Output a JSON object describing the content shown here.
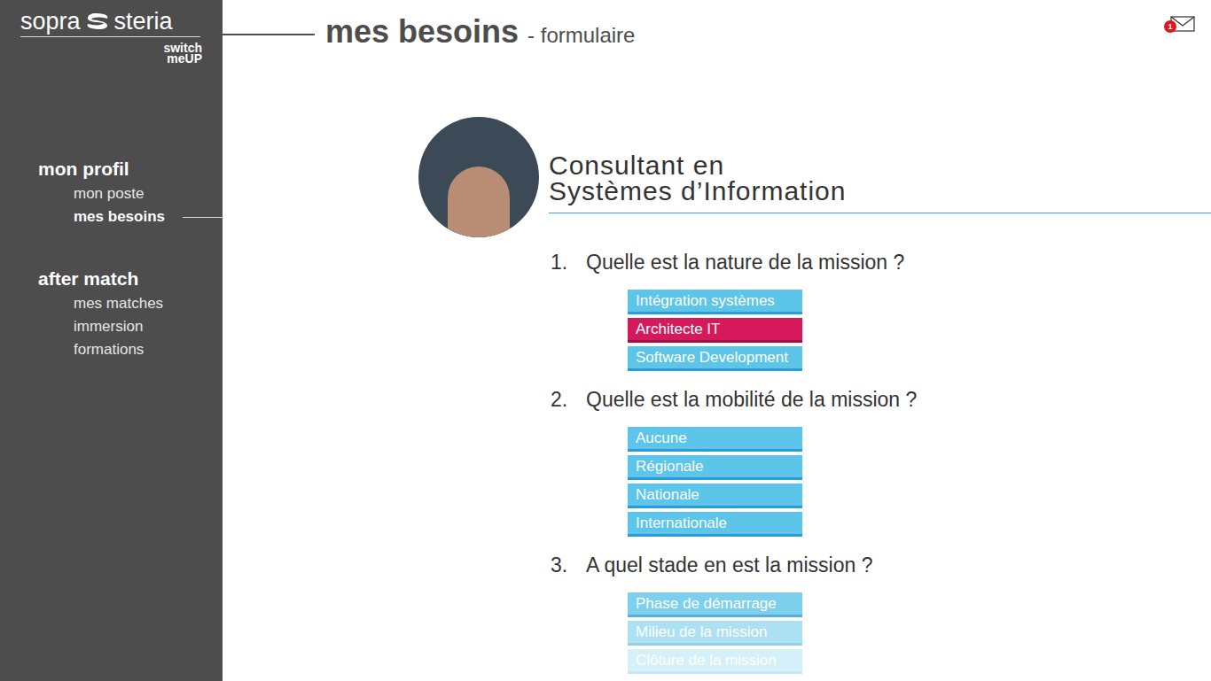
{
  "logo": {
    "left": "sopra",
    "right": "steria",
    "sub_top": "switch",
    "sub_bottom": "meUP"
  },
  "header": {
    "title": "mes besoins",
    "subtitle": "- formulaire"
  },
  "notifications": {
    "count": "1"
  },
  "sidebar": {
    "sections": [
      {
        "title": "mon profil",
        "items": [
          {
            "label": "mon poste",
            "selected": false
          },
          {
            "label": "mes besoins",
            "selected": true
          }
        ]
      },
      {
        "title": "after match",
        "items": [
          {
            "label": "mes matches",
            "selected": false
          },
          {
            "label": "immersion",
            "selected": false
          },
          {
            "label": "formations",
            "selected": false
          }
        ]
      }
    ]
  },
  "profile": {
    "title_lines": [
      "Consultant en",
      "Systèmes d’Information"
    ]
  },
  "questions": [
    {
      "number": "1.",
      "text": "Quelle est la nature de la mission ?",
      "options": [
        {
          "label": "Intégration systèmes",
          "selected": false,
          "opacity": 1
        },
        {
          "label": "Architecte IT",
          "selected": true,
          "opacity": 1
        },
        {
          "label": "Software Development",
          "selected": false,
          "opacity": 1
        }
      ]
    },
    {
      "number": "2.",
      "text": "Quelle est la mobilité de la mission ?",
      "options": [
        {
          "label": "Aucune",
          "selected": false,
          "opacity": 1
        },
        {
          "label": "Régionale",
          "selected": false,
          "opacity": 1
        },
        {
          "label": "Nationale",
          "selected": false,
          "opacity": 1
        },
        {
          "label": "Internationale",
          "selected": false,
          "opacity": 1
        }
      ]
    },
    {
      "number": "3.",
      "text": "A quel stade en est la mission ?",
      "options": [
        {
          "label": "Phase de démarrage",
          "selected": false,
          "opacity": 0.8
        },
        {
          "label": "Milieu de la mission",
          "selected": false,
          "opacity": 0.5
        },
        {
          "label": "Clôture de la mission",
          "selected": false,
          "opacity": 0.25
        }
      ]
    }
  ]
}
